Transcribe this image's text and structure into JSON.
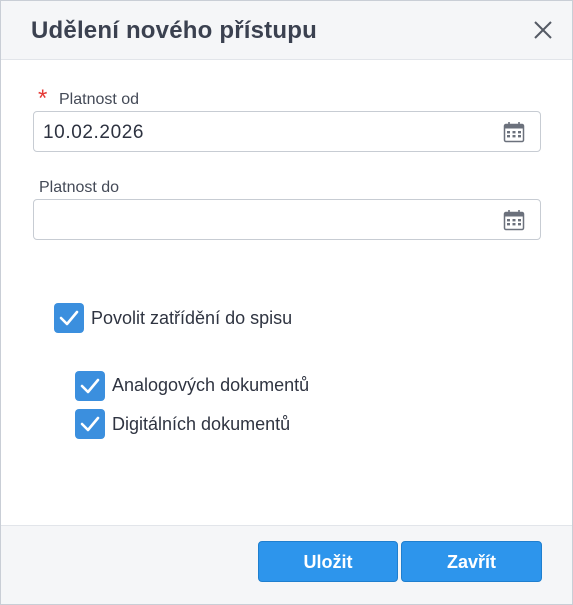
{
  "dialog": {
    "title": "Udělení nového přístupu",
    "close_icon": "close-icon"
  },
  "fields": {
    "valid_from": {
      "required_marker": "*",
      "label": "Platnost od",
      "value": "10.02.2026",
      "icon": "calendar-icon"
    },
    "valid_to": {
      "label": "Platnost do",
      "value": "",
      "icon": "calendar-icon"
    }
  },
  "checkboxes": {
    "allow_filing": {
      "label": "Povolit zatřídění do spisu",
      "checked": true
    },
    "analog_docs": {
      "label": "Analogových dokumentů",
      "checked": true
    },
    "digital_docs": {
      "label": "Digitálních dokumentů",
      "checked": true
    }
  },
  "buttons": {
    "save": "Uložit",
    "close": "Zavřít"
  },
  "colors": {
    "accent": "#2d95ec",
    "checkbox": "#3b8fde",
    "required": "#e53935",
    "title": "#3b4150"
  }
}
